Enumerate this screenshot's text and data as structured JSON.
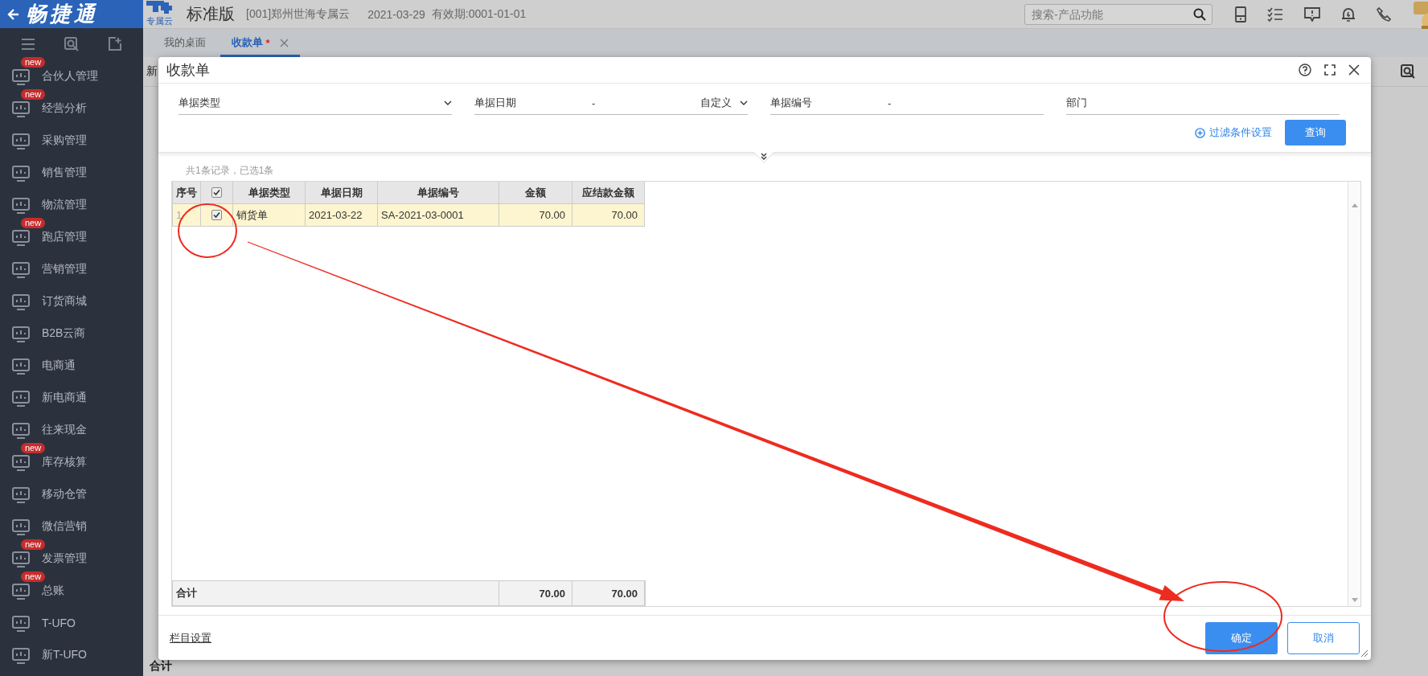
{
  "app": {
    "logo": "畅捷通",
    "product_badge": "专属云",
    "edition": "标准版",
    "company": "[001]郑州世海专属云",
    "date": "2021-03-29",
    "validity": "有效期:0001-01-01"
  },
  "search": {
    "placeholder": "搜索-产品功能"
  },
  "sidebar": {
    "items": [
      {
        "label": "合伙人管理",
        "badge": "new"
      },
      {
        "label": "经营分析",
        "badge": "new"
      },
      {
        "label": "采购管理"
      },
      {
        "label": "销售管理"
      },
      {
        "label": "物流管理"
      },
      {
        "label": "跑店管理",
        "badge": "new"
      },
      {
        "label": "营销管理"
      },
      {
        "label": "订货商城"
      },
      {
        "label": "B2B云商"
      },
      {
        "label": "电商通"
      },
      {
        "label": "新电商通"
      },
      {
        "label": "往来现金"
      },
      {
        "label": "库存核算",
        "badge": "new"
      },
      {
        "label": "移动仓管"
      },
      {
        "label": "微信营销"
      },
      {
        "label": "发票管理",
        "badge": "new"
      },
      {
        "label": "总账",
        "badge": "new"
      },
      {
        "label": "T-UFO"
      },
      {
        "label": "新T-UFO"
      }
    ]
  },
  "tabs": [
    {
      "label": "我的桌面",
      "selected": false
    },
    {
      "label": "收款单",
      "selected": true,
      "modified_mark": "*",
      "closable": true
    }
  ],
  "background_page": {
    "toolbar_text": "新",
    "footer_text": "合计"
  },
  "dialog": {
    "title": "收款单",
    "filters": [
      {
        "label": "单据类型",
        "kind": "select"
      },
      {
        "label": "单据日期",
        "kind": "date-range",
        "separator": "-",
        "range_option": "自定义"
      },
      {
        "label": "单据编号",
        "kind": "range",
        "separator": "-"
      },
      {
        "label": "部门",
        "kind": "text"
      }
    ],
    "filter_settings_link": "过滤条件设置",
    "query_button": "查询",
    "summary": "共1条记录，已选1条",
    "table": {
      "columns": [
        {
          "kind": "index",
          "label": "序号"
        },
        {
          "kind": "check",
          "checked": true
        },
        {
          "kind": "text",
          "label": "单据类型"
        },
        {
          "kind": "text",
          "label": "单据日期"
        },
        {
          "kind": "text",
          "label": "单据编号"
        },
        {
          "kind": "number",
          "label": "金额"
        },
        {
          "kind": "number",
          "label": "应结款金额"
        }
      ],
      "rows": [
        {
          "selected": true,
          "checked": true,
          "cells": [
            "1",
            "",
            "销货单",
            "2021-03-22",
            "SA-2021-03-0001",
            "70.00",
            "70.00"
          ]
        }
      ],
      "totals": {
        "label": "合计",
        "values": [
          "70.00",
          "70.00"
        ]
      }
    },
    "column_settings_link": "栏目设置",
    "buttons": [
      {
        "label": "确定",
        "kind": "primary"
      },
      {
        "label": "取消",
        "kind": "secondary"
      }
    ]
  },
  "annotations": [
    {
      "kind": "circle"
    },
    {
      "kind": "arrow"
    },
    {
      "kind": "circle"
    }
  ]
}
